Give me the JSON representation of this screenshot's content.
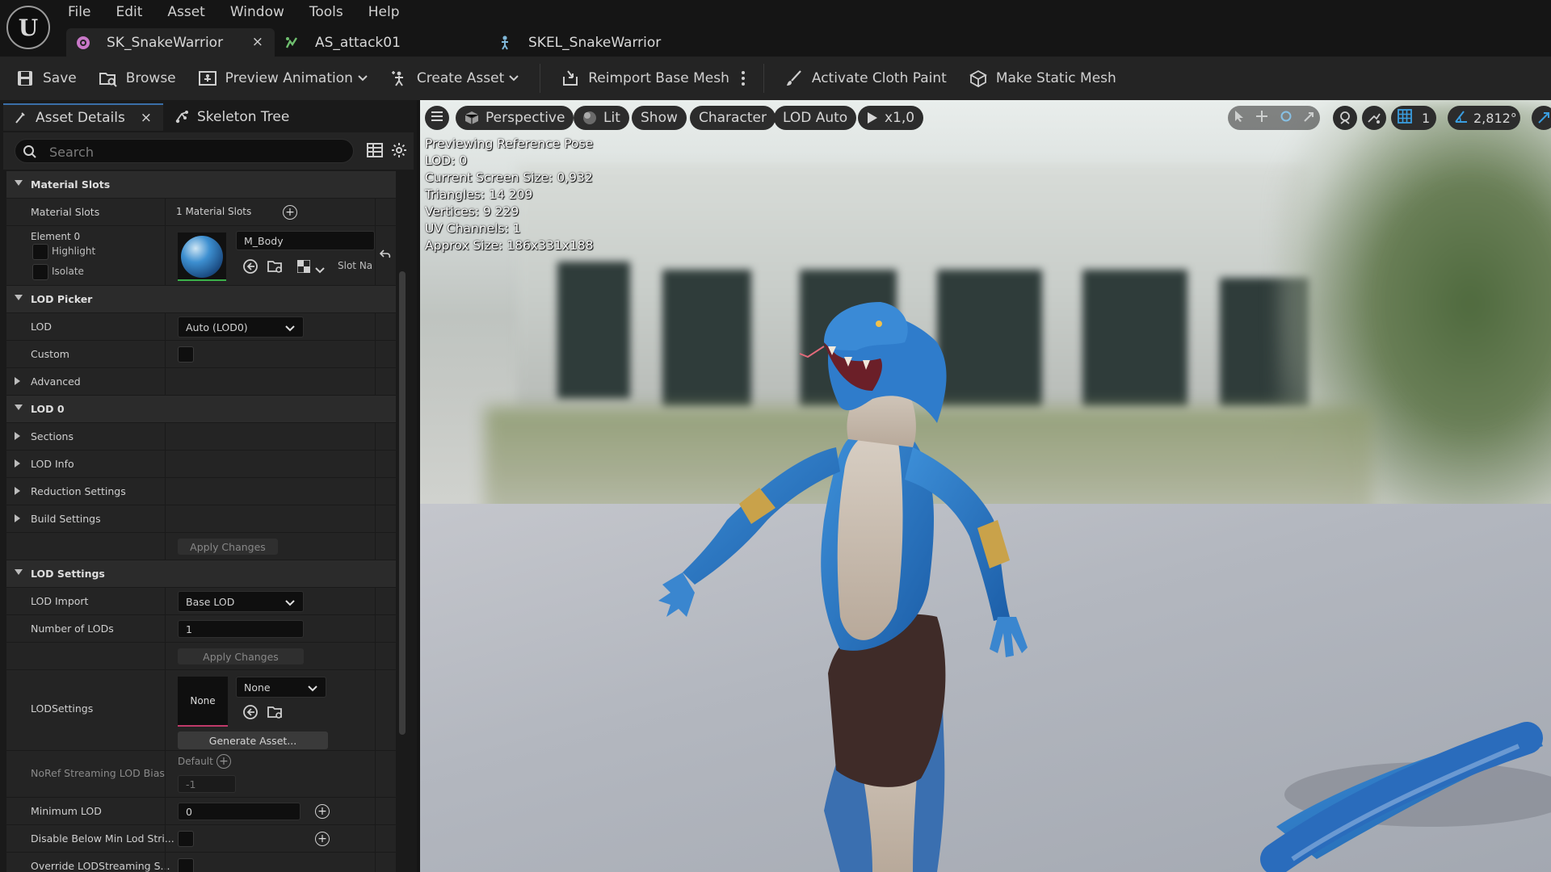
{
  "app": {
    "logo_text": "U"
  },
  "menu": [
    "File",
    "Edit",
    "Asset",
    "Window",
    "Tools",
    "Help"
  ],
  "tabs": [
    {
      "label": "SK_SnakeWarrior",
      "close": "×"
    },
    {
      "label": "AS_attack01"
    },
    {
      "label": "SKEL_SnakeWarrior"
    }
  ],
  "toolbar": {
    "save": "Save",
    "browse": "Browse",
    "preview_animation": "Preview Animation",
    "create_asset": "Create Asset",
    "reimport": "Reimport Base Mesh",
    "cloth_paint": "Activate Cloth Paint",
    "static_mesh": "Make Static Mesh"
  },
  "panel": {
    "tab_details": "Asset Details",
    "tab_details_close": "×",
    "tab_skeleton": "Skeleton Tree",
    "search_placeholder": "Search"
  },
  "details": {
    "material_slots_cat": "Material Slots",
    "material_slots_label": "Material Slots",
    "material_slots_value": "1 Material Slots",
    "element0": "Element 0",
    "highlight": "Highlight",
    "isolate": "Isolate",
    "material_name": "M_Body",
    "slot_name": "Slot Na",
    "lod_picker_cat": "LOD Picker",
    "lod_label": "LOD",
    "lod_value": "Auto (LOD0)",
    "custom_label": "Custom",
    "advanced_label": "Advanced",
    "lod0_cat": "LOD 0",
    "sections": "Sections",
    "lod_info": "LOD Info",
    "reduction_settings": "Reduction Settings",
    "build_settings": "Build Settings",
    "apply_changes": "Apply Changes",
    "lod_settings_cat": "LOD Settings",
    "lod_import_label": "LOD Import",
    "lod_import_value": "Base LOD",
    "num_lods_label": "Number of LODs",
    "num_lods_value": "1",
    "apply_changes_2": "Apply Changes",
    "lodsettings_label": "LODSettings",
    "lodsettings_thumb": "None",
    "lodsettings_combo": "None",
    "generate_asset": "Generate Asset...",
    "noref_label": "NoRef Streaming LOD Bias",
    "noref_default": "Default",
    "noref_value": "-1",
    "min_lod_label": "Minimum LOD",
    "min_lod_value": "0",
    "disable_below_label": "Disable Below Min Lod Stri...",
    "override_label": "Override LODStreaming S..."
  },
  "viewport": {
    "perspective": "Perspective",
    "lit": "Lit",
    "show": "Show",
    "character": "Character",
    "lod_auto": "LOD Auto",
    "play_speed": "x1,0",
    "grid_count": "1",
    "angle": "2,812°",
    "stats": [
      "Previewing Reference Pose",
      "LOD: 0",
      "Current Screen Size: 0,932",
      "Triangles: 14 209",
      "Vertices: 9 229",
      "UV Channels: 1",
      "Approx Size: 186x331x188"
    ]
  },
  "colors": {
    "accent": "#3a6fa8",
    "panel_bg": "#242424",
    "category_bg": "#2b2b2b",
    "field_bg": "#0f0f0f"
  }
}
